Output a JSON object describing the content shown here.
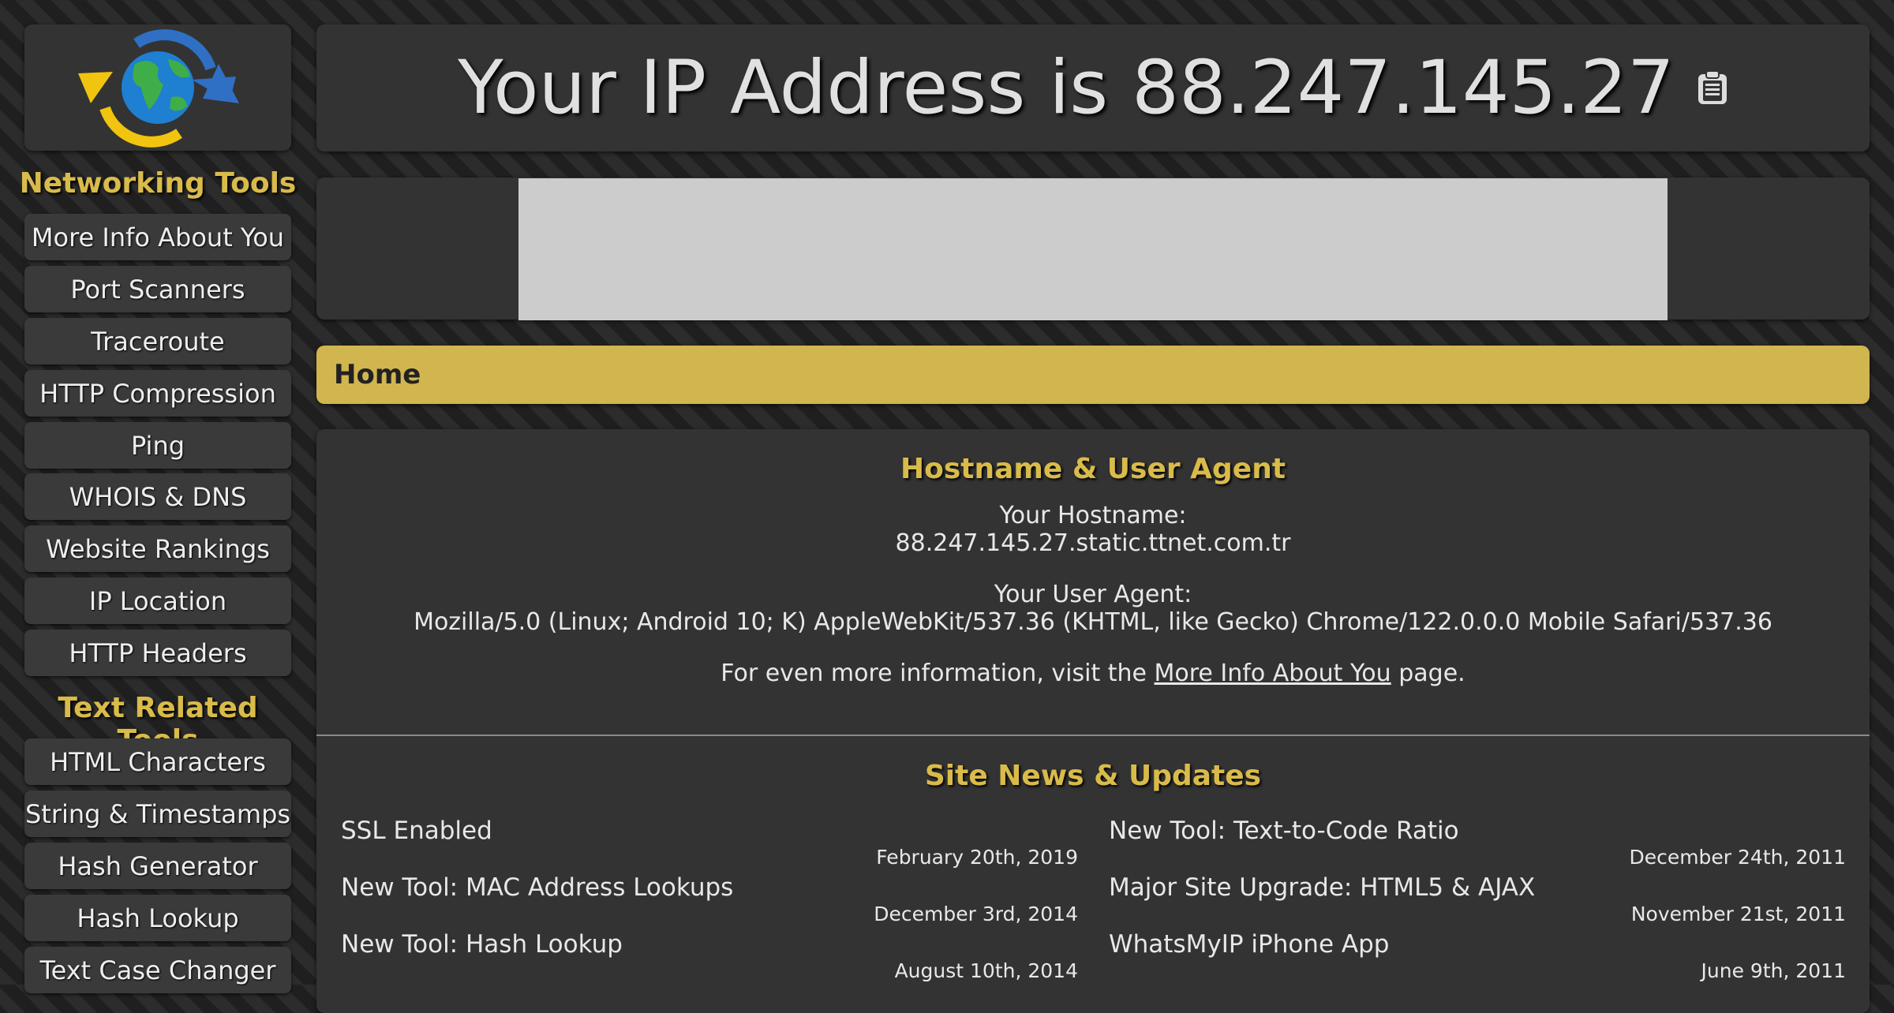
{
  "logo": {
    "icon": "globe-arrows-icon"
  },
  "sidebar": {
    "networking_heading": "Networking Tools",
    "networking_items": [
      "More Info About You",
      "Port Scanners",
      "Traceroute",
      "HTTP Compression",
      "Ping",
      "WHOIS & DNS",
      "Website Rankings",
      "IP Location",
      "HTTP Headers"
    ],
    "text_heading": "Text Related Tools",
    "text_items": [
      "HTML Characters",
      "String & Timestamps",
      "Hash Generator",
      "Hash Lookup",
      "Text Case Changer"
    ]
  },
  "header": {
    "title": "Your IP Address is 88.247.145.27",
    "copy_icon": "clipboard-icon"
  },
  "breadcrumb": {
    "label": "Home"
  },
  "hostname_section": {
    "heading": "Hostname & User Agent",
    "hostname_label": "Your Hostname:",
    "hostname_value": "88.247.145.27.static.ttnet.com.tr",
    "ua_label": "Your User Agent:",
    "ua_value": "Mozilla/5.0 (Linux; Android 10; K) AppleWebKit/537.36 (KHTML, like Gecko) Chrome/122.0.0.0 Mobile Safari/537.36",
    "more_prefix": "For even more information, visit the ",
    "more_link": "More Info About You",
    "more_suffix": " page."
  },
  "news": {
    "heading": "Site News & Updates",
    "left": [
      {
        "title": "SSL Enabled",
        "date": "February 20th, 2019"
      },
      {
        "title": "New Tool: MAC Address Lookups",
        "date": "December 3rd, 2014"
      },
      {
        "title": "New Tool: Hash Lookup",
        "date": "August 10th, 2014"
      }
    ],
    "right": [
      {
        "title": "New Tool: Text-to-Code Ratio",
        "date": "December 24th, 2011"
      },
      {
        "title": "Major Site Upgrade: HTML5 & AJAX",
        "date": "November 21st, 2011"
      },
      {
        "title": "WhatsMyIP iPhone App",
        "date": "June 9th, 2011"
      }
    ]
  },
  "colors": {
    "accent": "#d9bb4a",
    "breadcrumb_bg": "#d1b54e",
    "panel_bg": "#333333"
  }
}
